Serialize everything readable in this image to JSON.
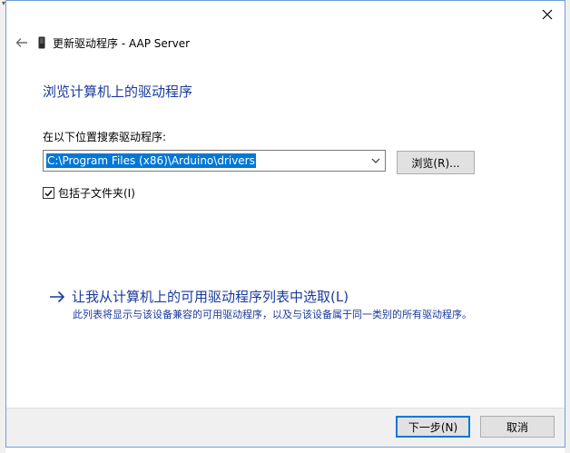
{
  "window": {
    "title": "更新驱动程序 - AAP Server"
  },
  "icons": {
    "close": "close-icon",
    "back": "back-arrow-icon",
    "device": "device-icon",
    "dropdown": "chevron-down-icon",
    "checkmark": "checkmark-icon",
    "link_arrow": "arrow-right-icon"
  },
  "colors": {
    "heading": "#1a3a9c",
    "selection": "#0078d7",
    "border_accent": "#6f9fd8"
  },
  "main": {
    "heading": "浏览计算机上的驱动程序",
    "search_label": "在以下位置搜索驱动程序:",
    "path_value": "C:\\Program Files (x86)\\Arduino\\drivers",
    "browse_label": "浏览(R)...",
    "include_subfolders": {
      "label": "包括子文件夹(I)",
      "checked": true
    },
    "pick_from_list": {
      "title": "让我从计算机上的可用驱动程序列表中选取(L)",
      "description": "此列表将显示与该设备兼容的可用驱动程序，以及与该设备属于同一类别的所有驱动程序。"
    }
  },
  "footer": {
    "next_label": "下一步(N)",
    "cancel_label": "取消"
  }
}
